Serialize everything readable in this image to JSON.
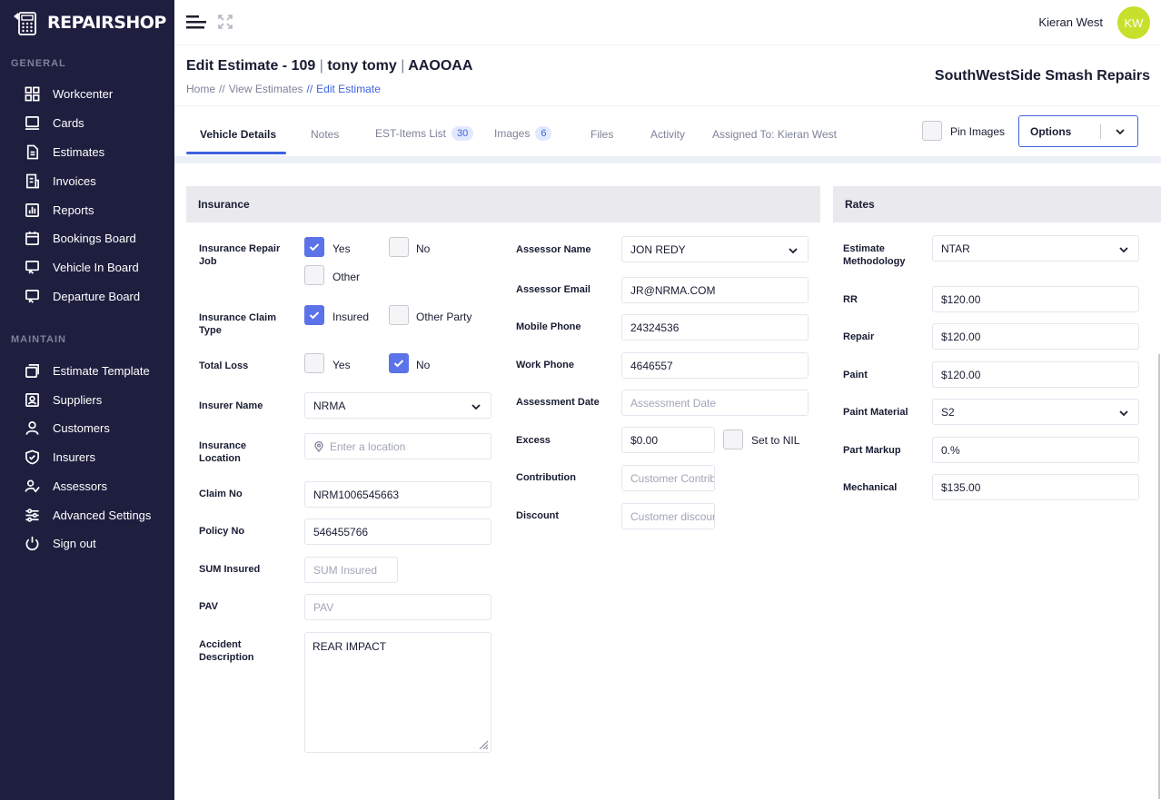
{
  "app": {
    "logo_text": "REPAIRSHOP"
  },
  "sidebar": {
    "general_title": "GENERAL",
    "general_items": [
      {
        "label": "Workcenter",
        "icon": "grid-icon"
      },
      {
        "label": "Cards",
        "icon": "card-icon"
      },
      {
        "label": "Estimates",
        "icon": "document-icon"
      },
      {
        "label": "Invoices",
        "icon": "invoice-icon"
      },
      {
        "label": "Reports",
        "icon": "chart-icon"
      },
      {
        "label": "Bookings Board",
        "icon": "calendar-icon"
      },
      {
        "label": "Vehicle In Board",
        "icon": "monitor-icon"
      },
      {
        "label": "Departure Board",
        "icon": "monitor-icon"
      }
    ],
    "maintain_title": "MAINTAIN",
    "maintain_items": [
      {
        "label": "Estimate Template",
        "icon": "template-icon"
      },
      {
        "label": "Suppliers",
        "icon": "contact-icon"
      },
      {
        "label": "Customers",
        "icon": "user-icon"
      },
      {
        "label": "Insurers",
        "icon": "shield-icon"
      },
      {
        "label": "Assessors",
        "icon": "user-check-icon"
      },
      {
        "label": "Advanced Settings",
        "icon": "sliders-icon"
      },
      {
        "label": "Sign out",
        "icon": "power-icon"
      }
    ]
  },
  "topbar": {
    "user_name": "Kieran West",
    "avatar_initials": "KW",
    "avatar_color": "#c7e02c"
  },
  "header": {
    "title_main": "Edit Estimate - 109",
    "separator": "|",
    "title_customer": "tony tomy",
    "title_rego": "AAOOAA",
    "breadcrumb": {
      "home": "Home",
      "sep": "//",
      "view": "View Estimates",
      "current": "Edit Estimate"
    },
    "company": "SouthWestSide Smash Repairs"
  },
  "tabs": {
    "vehicle": "Vehicle Details",
    "notes": "Notes",
    "items": "EST-Items List",
    "items_count": "30",
    "images": "Images",
    "images_count": "6",
    "files": "Files",
    "activity": "Activity",
    "assigned": "Assigned To: Kieran West",
    "pin_images": "Pin Images",
    "options": "Options"
  },
  "insurance": {
    "title": "Insurance",
    "repair_job_label": "Insurance Repair Job",
    "yes": "Yes",
    "no": "No",
    "other": "Other",
    "claim_type_label": "Insurance Claim Type",
    "insured": "Insured",
    "other_party": "Other Party",
    "total_loss_label": "Total Loss",
    "insurer_name_label": "Insurer Name",
    "insurer_name_value": "NRMA",
    "location_label": "Insurance Location",
    "location_placeholder": "Enter a location",
    "claim_no_label": "Claim No",
    "claim_no_value": "NRM1006545663",
    "policy_no_label": "Policy No",
    "policy_no_value": "546455766",
    "sum_insured_label": "SUM Insured",
    "sum_insured_placeholder": "SUM Insured",
    "pav_label": "PAV",
    "pav_placeholder": "PAV",
    "accident_label": "Accident Description",
    "accident_value": "REAR IMPACT",
    "assessor_name_label": "Assessor Name",
    "assessor_name_value": "JON REDY",
    "assessor_email_label": "Assessor Email",
    "assessor_email_value": "JR@NRMA.COM",
    "mobile_label": "Mobile Phone",
    "mobile_value": "24324536",
    "work_label": "Work Phone",
    "work_value": "4646557",
    "assessment_date_label": "Assessment Date",
    "assessment_date_placeholder": "Assessment Date",
    "excess_label": "Excess",
    "excess_value": "$0.00",
    "set_nil": "Set to NIL",
    "contribution_label": "Contribution",
    "contribution_placeholder": "Customer Contrib",
    "discount_label": "Discount",
    "discount_placeholder": "Customer discour"
  },
  "rates": {
    "title": "Rates",
    "methodology_label": "Estimate Methodology",
    "methodology_value": "NTAR",
    "rr_label": "RR",
    "rr_value": "$120.00",
    "repair_label": "Repair",
    "repair_value": "$120.00",
    "paint_label": "Paint",
    "paint_value": "$120.00",
    "paint_material_label": "Paint Material",
    "paint_material_value": "S2",
    "part_markup_label": "Part Markup",
    "part_markup_value": "0.%",
    "mechanical_label": "Mechanical",
    "mechanical_value": "$135.00"
  }
}
